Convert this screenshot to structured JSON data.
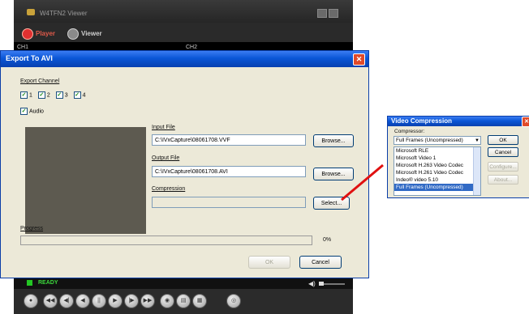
{
  "viewer": {
    "title": "W4TFN2 Viewer",
    "tabs": [
      {
        "label": "Player",
        "color": "#e03030"
      },
      {
        "label": "Viewer",
        "color": "#9a9a9a"
      }
    ],
    "channels": [
      "CH1",
      "CH2"
    ],
    "status": "READY",
    "accent_status": "#23c623"
  },
  "export_dialog": {
    "title": "Export To AVI",
    "export_channel_label": "Export Channel",
    "channels": [
      {
        "label": "1",
        "checked": true
      },
      {
        "label": "2",
        "checked": true
      },
      {
        "label": "3",
        "checked": true
      },
      {
        "label": "4",
        "checked": true
      }
    ],
    "audio": {
      "label": "Audio",
      "checked": true
    },
    "input_file_label": "Input File",
    "input_file_value": "C:\\IVxCapture\\08061708.VVF",
    "browse_label": "Browse...",
    "output_file_label": "Output File",
    "output_file_value": "C:\\IVxCapture\\08061708.AVI",
    "compression_label": "Compression",
    "compression_value": "",
    "select_label": "Select...",
    "progress_label": "Progress",
    "progress_percent": "0%",
    "ok_label": "OK",
    "cancel_label": "Cancel"
  },
  "video_compression": {
    "title": "Video Compression",
    "compressor_label": "Compressor:",
    "selected": "Full Frames (Uncompressed)",
    "options": [
      "Microsoft RLE",
      "Microsoft Video 1",
      "Microsoft H.263 Video Codec",
      "Microsoft H.261 Video Codec",
      "Indeo® video 5.10",
      "Full Frames (Uncompressed)"
    ],
    "selected_index": 5,
    "ok_label": "OK",
    "cancel_label": "Cancel",
    "configure_label": "Configure...",
    "about_label": "About..."
  },
  "colors": {
    "titlebar_blue": "#0a56d6",
    "dialog_face": "#ece9d8",
    "arrow": "#e01010"
  }
}
